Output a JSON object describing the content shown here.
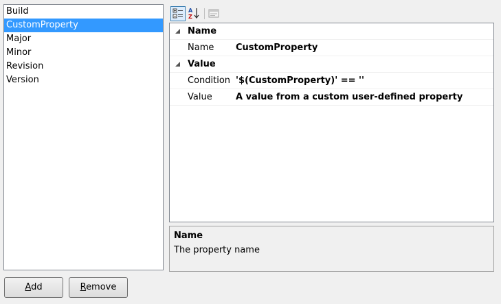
{
  "list": {
    "items": [
      "Build",
      "CustomProperty",
      "Major",
      "Minor",
      "Revision",
      "Version"
    ],
    "selected_index": 1
  },
  "toolbar": {
    "categorized_icon": "categorized-icon",
    "alphabetical_icon": "sort-alphabetical-icon",
    "property_pages_icon": "property-pages-icon"
  },
  "grid": {
    "categories": [
      {
        "label": "Name",
        "properties": [
          {
            "name": "Name",
            "value": "CustomProperty"
          }
        ]
      },
      {
        "label": "Value",
        "properties": [
          {
            "name": "Condition",
            "value": "'$(CustomProperty)' == ''"
          },
          {
            "name": "Value",
            "value": "A value from a custom user-defined property"
          }
        ]
      }
    ]
  },
  "help": {
    "title": "Name",
    "description": "The property name"
  },
  "buttons": {
    "add": {
      "mnemonic": "A",
      "rest": "dd"
    },
    "remove": {
      "mnemonic": "R",
      "rest": "emove"
    }
  },
  "colors": {
    "selection": "#3399ff",
    "window_bg": "#f0f0f0",
    "border": "#828790"
  }
}
